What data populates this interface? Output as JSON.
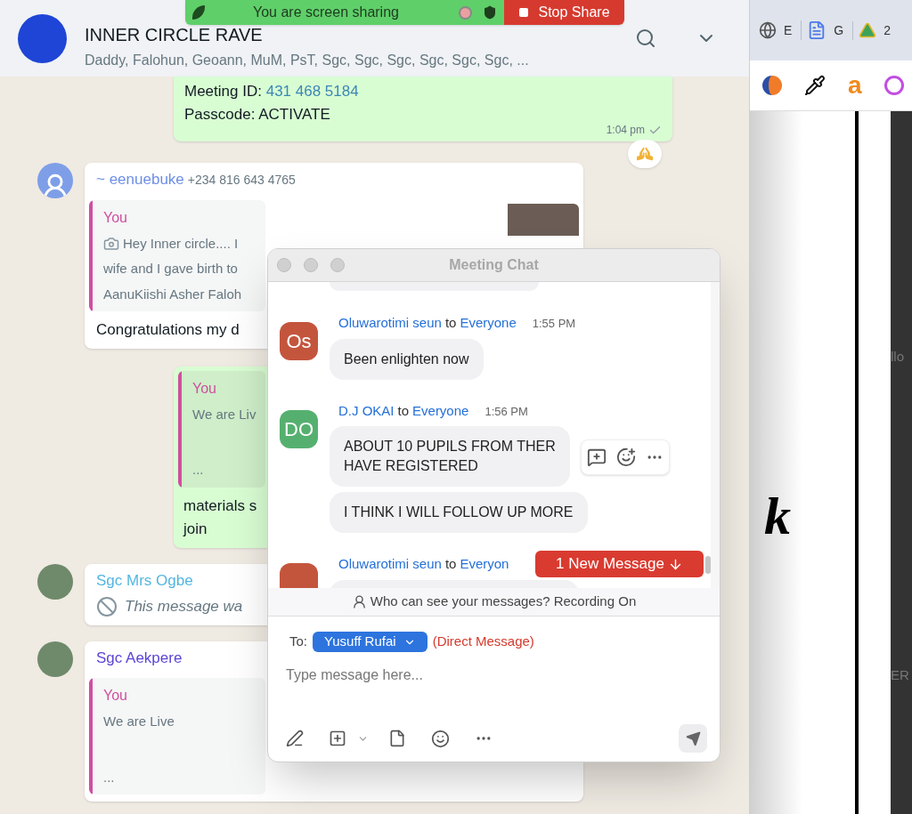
{
  "screen_share_banner": {
    "status": "You are screen sharing",
    "stop_button": "Stop Share"
  },
  "whatsapp": {
    "header": {
      "title": "INNER CIRCLE RAVE",
      "members": "Daddy, Falohun, Geoann, MuM, PsT, Sgc, Sgc, Sgc, Sgc, Sgc, Sgc, ..."
    },
    "messages": [
      {
        "kind": "outgoing_meeting",
        "meeting_id_label": "Meeting ID:",
        "meeting_id": "431 468 5184",
        "passcode": "Passcode: ACTIVATE",
        "time": "1:04 pm",
        "delivered": true,
        "reacted": true
      },
      {
        "kind": "incoming",
        "sender": "~ eenuebuke",
        "color": "#6f8fe6",
        "phone": "+234 816 643 4765",
        "quote": {
          "author": "You",
          "photo": true,
          "lines": [
            "Hey Inner circle.... I",
            "wife and I gave birth to",
            "AanuKiishi Asher Faloh"
          ]
        },
        "text_lines": [
          "Congratulations my d"
        ]
      },
      {
        "kind": "outgoing",
        "quote": {
          "author": "You",
          "photo": false,
          "lines": [
            "We are Liv",
            "..."
          ]
        },
        "text_lines": [
          "materials s",
          "join"
        ]
      },
      {
        "kind": "incoming",
        "sender": "Sgc Mrs Ogbe",
        "color": "#53b6e0",
        "deleted_text": "This message wa"
      },
      {
        "kind": "incoming",
        "sender": "Sgc Aekpere",
        "color": "#5b45d6",
        "quote": {
          "author": "You",
          "photo": false,
          "lines": [
            "We are Live",
            "..."
          ]
        }
      }
    ]
  },
  "meeting_chat": {
    "title": "Meeting Chat",
    "messages": [
      {
        "sender": "Oluwarotimi seun",
        "to": "to",
        "recipient": "Everyone",
        "time": "1:55 PM",
        "initials": "Os",
        "color": "#c4553d",
        "bubbles": [
          [
            "Been enlighten now"
          ]
        ]
      },
      {
        "sender": "D.J OKAI",
        "to": "to",
        "recipient": "Everyone",
        "time": "1:56 PM",
        "initials": "DO",
        "color": "#55b06f",
        "hover_toolbar": true,
        "bubbles": [
          [
            "ABOUT 10 PUPILS FROM THER",
            "HAVE REGISTERED"
          ],
          [
            "I THINK I WILL FOLLOW UP MORE"
          ]
        ]
      },
      {
        "sender": "Oluwarotimi seun",
        "to": "to",
        "recipient": "Everyon",
        "color": "#c4553d"
      }
    ],
    "new_messages": "1 New Message",
    "privacy_note": "Who can see your messages? Recording On",
    "to_label": "To:",
    "recipient": "Yusuff Rufai",
    "direct_note": "(Direct Message)",
    "placeholder": "Type message here..."
  },
  "browser": {
    "tabs": [
      {
        "label": "E"
      },
      {
        "label": "G"
      },
      {
        "label": "2"
      }
    ],
    "toolbar_letter": "a",
    "page_letter": "k",
    "panel_texts": [
      "llo",
      "ER"
    ]
  }
}
